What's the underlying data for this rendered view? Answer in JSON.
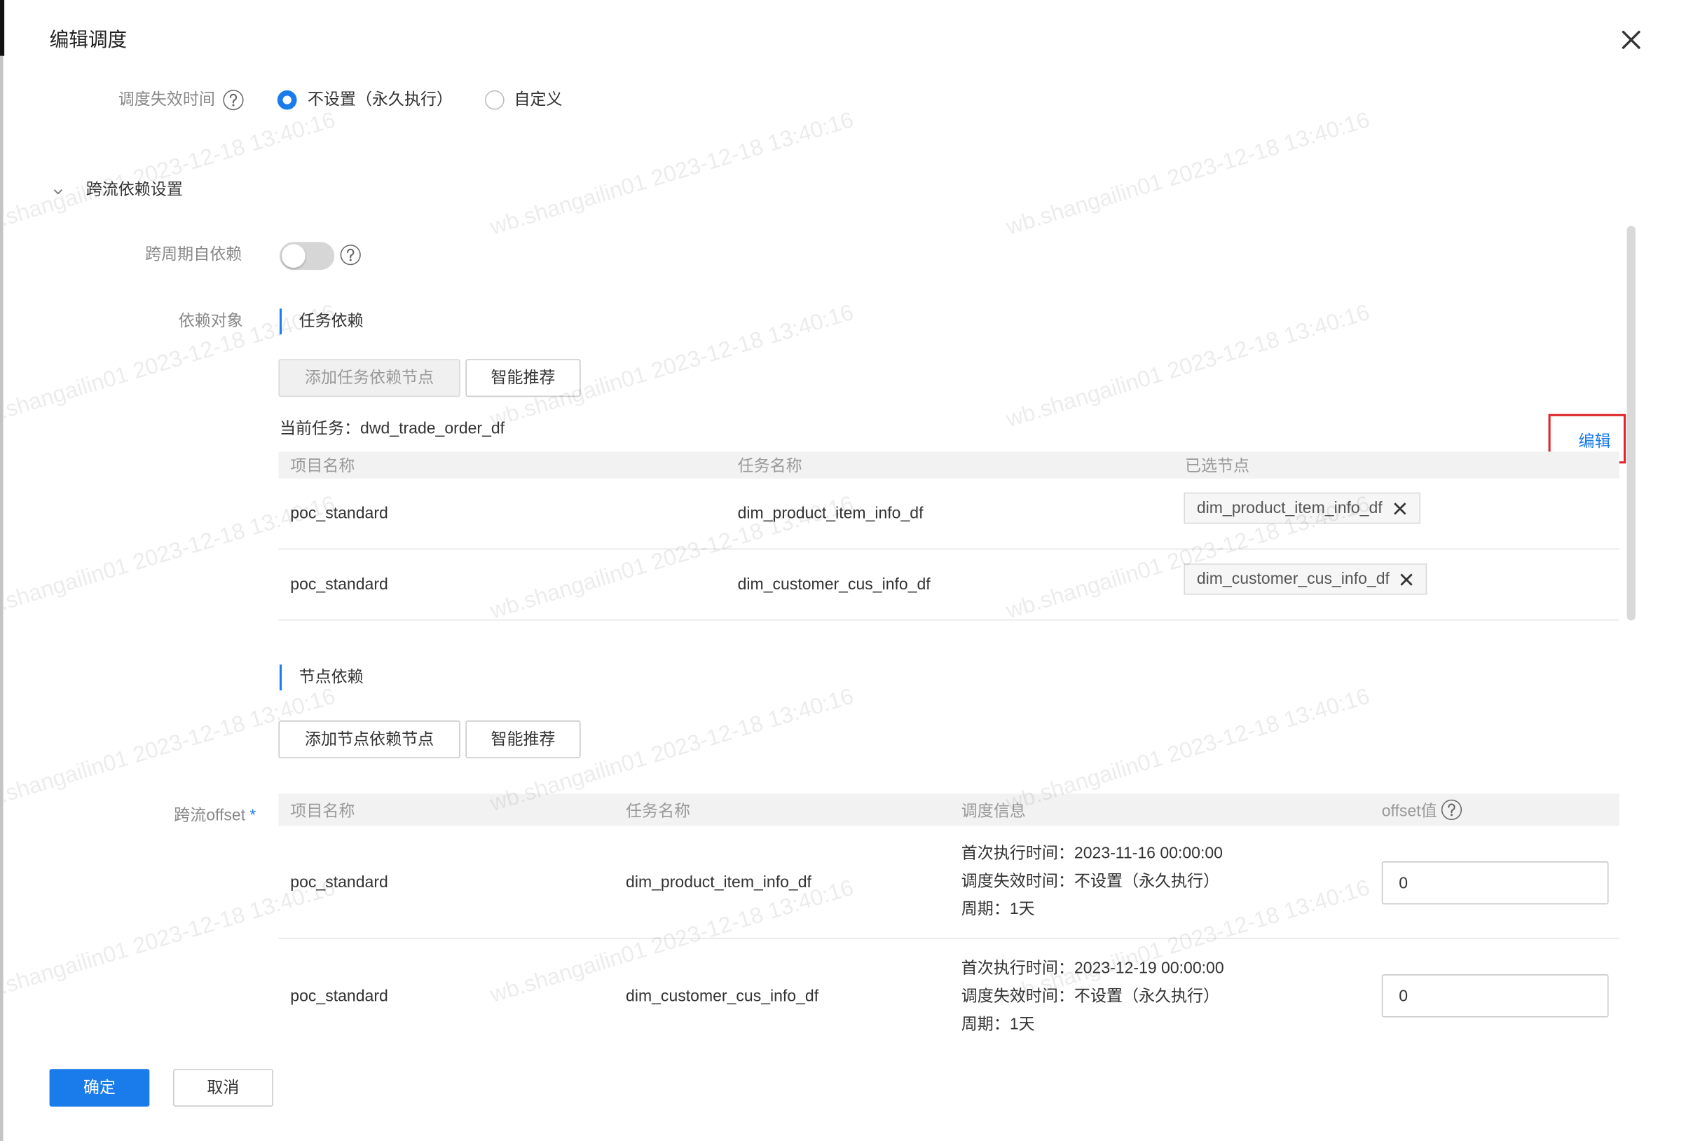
{
  "dialog": {
    "title": "编辑调度"
  },
  "expiry": {
    "label": "调度失效时间",
    "options": [
      {
        "label": "不设置（永久执行）",
        "checked": true
      },
      {
        "label": "自定义",
        "checked": false
      }
    ]
  },
  "cross_flow": {
    "section_title": "跨流依赖设置",
    "expanded": true,
    "self_dependency": {
      "label": "跨周期自依赖",
      "enabled": false
    },
    "dependency_target_label": "依赖对象",
    "task_dependency": {
      "title": "任务依赖",
      "add_button": "添加任务依赖节点",
      "add_button_disabled": true,
      "recommend_button": "智能推荐",
      "current_task_label": "当前任务：",
      "current_task": "dwd_trade_order_df",
      "edit_link": "编辑",
      "columns": [
        "项目名称",
        "任务名称",
        "已选节点"
      ],
      "rows": [
        {
          "project": "poc_standard",
          "task": "dim_product_item_info_df",
          "selected": "dim_product_item_info_df"
        },
        {
          "project": "poc_standard",
          "task": "dim_customer_cus_info_df",
          "selected": "dim_customer_cus_info_df"
        }
      ]
    },
    "node_dependency": {
      "title": "节点依赖",
      "add_button": "添加节点依赖节点",
      "recommend_button": "智能推荐"
    },
    "offset": {
      "label": "跨流offset",
      "required_mark": "*",
      "columns": [
        "项目名称",
        "任务名称",
        "调度信息",
        "offset值"
      ],
      "rows": [
        {
          "project": "poc_standard",
          "task": "dim_product_item_info_df",
          "first_run_label": "首次执行时间：",
          "first_run": "2023-11-16 00:00:00",
          "expiry_label": "调度失效时间：",
          "expiry": "不设置（永久执行）",
          "period_label": "周期：",
          "period": "1天",
          "offset": "0"
        },
        {
          "project": "poc_standard",
          "task": "dim_customer_cus_info_df",
          "first_run_label": "首次执行时间：",
          "first_run": "2023-12-19 00:00:00",
          "expiry_label": "调度失效时间：",
          "expiry": "不设置（永久执行）",
          "period_label": "周期：",
          "period": "1天",
          "offset": "0"
        }
      ]
    }
  },
  "footer": {
    "confirm": "确定",
    "cancel": "取消"
  },
  "watermark": "wb.shangailin01 2023-12-18 13:40:16",
  "colors": {
    "accent": "#1a7bea",
    "highlight_box": "#e0262a",
    "table_header_bg": "#f2f2f2"
  },
  "icons": {
    "close": "close-icon",
    "help": "question-circle-icon",
    "collapse": "chevron-down-icon",
    "remove_tag": "close-small-icon"
  }
}
